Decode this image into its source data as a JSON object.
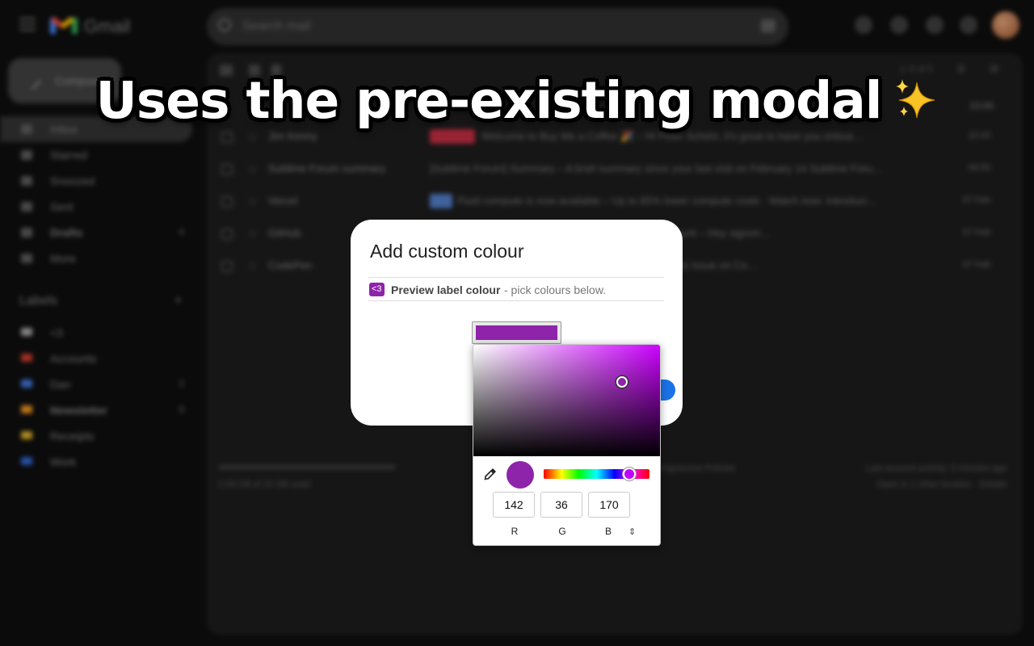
{
  "colors": {
    "label": "#8e24aa",
    "hue": "#cc00ff",
    "modal_bg": "#ffffff",
    "accent": "#1a73e8"
  },
  "headline": {
    "text": "Uses the pre-existing modal",
    "emoji": "sparkles"
  },
  "gmail": {
    "app_name": "Gmail",
    "search_placeholder": "Search mail",
    "compose_label": "Compose",
    "nav": [
      {
        "label": "Inbox",
        "count": ""
      },
      {
        "label": "Starred",
        "count": ""
      },
      {
        "label": "Snoozed",
        "count": ""
      },
      {
        "label": "Sent",
        "count": ""
      },
      {
        "label": "Drafts",
        "count": "4"
      },
      {
        "label": "More",
        "count": ""
      }
    ],
    "labels_title": "Labels",
    "labels": [
      {
        "name": "<3",
        "count": "",
        "color": "#9a9a9a"
      },
      {
        "name": "Accounts",
        "count": "",
        "color": "#c0392b"
      },
      {
        "name": "Dan",
        "count": "2",
        "color": "#3d6fd1"
      },
      {
        "name": "Newsletter",
        "count": "9",
        "color": "#e08a1e"
      },
      {
        "name": "Receipts",
        "count": "",
        "color": "#c9a227"
      },
      {
        "name": "Work",
        "count": "",
        "color": "#2d5fc4"
      }
    ],
    "page_info": "1–5 of 5",
    "column_header": "10:00",
    "rows": [
      {
        "sender": "Jim Kenny",
        "subject": "Welcome to Buy Me a Coffee 🎉 – Hi Peter Schein, it's great to have you onboa…",
        "time": "10:43",
        "tag_color": "#b32a3c"
      },
      {
        "sender": "Sublime Forum summary",
        "subject": "[Sublime Forum] Summary – A brief summary since your last visit on February 14 Sublime Foru…",
        "time": "09:55",
        "tag_color": ""
      },
      {
        "sender": "Vercel",
        "subject": "Fluid compute is now available – Up to 85% lower compute costs · Watch now: Introduci…",
        "time": "07 Feb",
        "tag_color": "#4a72b8"
      },
      {
        "sender": "GitHub",
        "subject": "[GitHub] A new SSH key has been added to your account – Hey signori…",
        "time": "07 Feb",
        "tag_color": ""
      },
      {
        "sender": "CodePen",
        "subject": "Your weekly dose: JavaScript Claw Machine – View this issue on Co…",
        "time": "07 Feb",
        "tag_color": ""
      }
    ],
    "storage_used": "0.08 GB of 15 GB used",
    "terms": "Terms · Privacy · Programme Policies",
    "activity": "Last account activity: 9 minutes ago",
    "details": "Open in 1 other location · Details"
  },
  "modal": {
    "title": "Add custom colour",
    "preview_chip": "<3",
    "preview_strong": "Preview label colour",
    "preview_rest": "- pick colours below."
  },
  "picker": {
    "saturation": 0.79,
    "value": 0.67,
    "hue_fraction": 0.81,
    "r": "142",
    "g": "36",
    "b": "170",
    "r_label": "R",
    "g_label": "G",
    "b_label": "B",
    "mode_toggle": "⇕"
  }
}
